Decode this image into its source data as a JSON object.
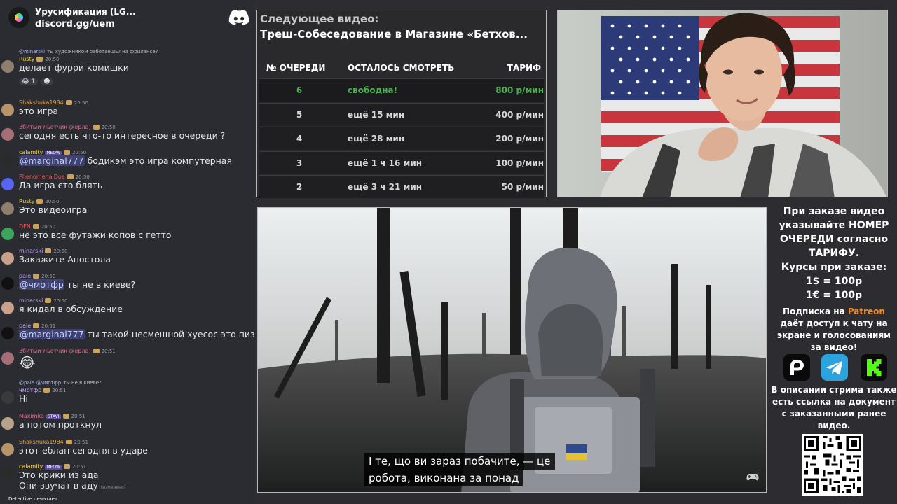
{
  "server": {
    "name": "Урусификация (LG...",
    "link": "discord.gg/uem"
  },
  "messages": [
    {
      "reply": {
        "user": "@minarski",
        "text": "ты художником работаешь? на фрилансе?"
      },
      "author": "Rusty",
      "author_color": "#e8d25a",
      "time": "20:50",
      "text": "делает фурри комишки",
      "reactions": [
        "😂 1",
        "☻"
      ]
    },
    {
      "author": "Shakshuka1984",
      "author_color": "#e8a23c",
      "time": "20:50",
      "text": "это игра"
    },
    {
      "author": "Збитый Льотчик (херла)",
      "author_color": "#e86a8c",
      "time": "20:50",
      "text": "сегодня есть что-то интересное в очереди ?"
    },
    {
      "author": "calamity",
      "author_color": "#ffd54a",
      "time": "20:50",
      "tag": "MEOW",
      "mention": "@marginal777",
      "text": "бодикэм это игра компутерная"
    },
    {
      "author": "PhenomenalDoe",
      "author_color": "#e85a5a",
      "time": "20:50",
      "text": "Да игра єто блять"
    },
    {
      "author": "Rusty",
      "author_color": "#e8d25a",
      "time": "20:50",
      "text": "Это видеоигра"
    },
    {
      "author": "DFN",
      "author_color": "#e85a5a",
      "time": "20:50",
      "text": "не это все футажи копов с гетто"
    },
    {
      "author": "minarski",
      "author_color": "#c3a6ff",
      "time": "20:50",
      "text": "Закажите Апостола"
    },
    {
      "author": "pale",
      "author_color": "#c3a6ff",
      "time": "20:50",
      "mention": "@чмотфр",
      "text": "ты не в киеве?"
    },
    {
      "author": "minarski",
      "author_color": "#c3a6ff",
      "time": "20:50",
      "text": "я кидал в обсуждение"
    },
    {
      "author": "pale",
      "author_color": "#c3a6ff",
      "time": "20:51",
      "mention": "@marginal777",
      "text": "ты такой несмешной хуесос это пизда"
    },
    {
      "author": "Збитый Льотчик (херла)",
      "author_color": "#e86a8c",
      "time": "20:51",
      "text": "😂"
    },
    {
      "reply": {
        "user": "@pale",
        "mention": "@чмотфр",
        "text": "ты не в киеве?"
      },
      "author": "чмотфр",
      "author_color": "#c3a6ff",
      "time": "20:51",
      "text": "Hi"
    },
    {
      "author": "Maximka",
      "author_color": "#e86a8c",
      "time": "20:51",
      "tag": "STAVI",
      "text": "а потом проткнул"
    },
    {
      "author": "Shakshuka1984",
      "author_color": "#e8a23c",
      "time": "20:51",
      "text": "этот еблан сегодня в ударе"
    },
    {
      "author": "calamity",
      "author_color": "#ffd54a",
      "time": "20:51",
      "tag": "MEOW",
      "text": "Это крики из ада",
      "text2": "Они звучат в аду",
      "edited": "(изменено)"
    }
  ],
  "typing": "Detective печатает...",
  "next_video": {
    "label": "Следующее видео:",
    "title": "Треш-Собеседование в Магазине «Бетхов..."
  },
  "queue": {
    "headers": [
      "№ ОЧЕРЕДИ",
      "ОСТАЛОСЬ СМОТРЕТЬ",
      "ТАРИФ"
    ],
    "rows": [
      {
        "num": "6",
        "left": "свободна!",
        "rate": "800 р/мин",
        "highlight": true
      },
      {
        "num": "5",
        "left": "ещё 15 мин",
        "rate": "400 р/мин"
      },
      {
        "num": "4",
        "left": "ещё 28 мин",
        "rate": "200 р/мин"
      },
      {
        "num": "3",
        "left": "ещё 1 ч 16 мин",
        "rate": "100 р/мин"
      },
      {
        "num": "2",
        "left": "ещё 3 ч 21 мин",
        "rate": "50 р/мин"
      }
    ]
  },
  "subtitle": {
    "line1": "І те, що ви зараз побачите, — це",
    "line2": "робота, виконана за понад"
  },
  "info": {
    "order_text": [
      "При заказе видео",
      "указывайте НОМЕР",
      "ОЧЕРЕДИ согласно",
      "ТАРИФУ."
    ],
    "rates_title": "Курсы при заказе:",
    "rate_usd": "1$ = 100р",
    "rate_eur": "1€ = 100р",
    "sub_prefix": "Подписка на ",
    "sub_patreon": "Patreon",
    "sub_rest": [
      "даёт доступ к чату на",
      "экране и голосованиям",
      "за видео!"
    ],
    "desc": [
      "В описании стрима также",
      "есть ссылка на документ",
      "с заказанными ранее",
      "видео."
    ]
  },
  "colors": {
    "accent_green": "#4caf50",
    "patreon_orange": "#f08a24",
    "mention_bg": "#3d4270",
    "discord_bg": "#2b2c31"
  }
}
